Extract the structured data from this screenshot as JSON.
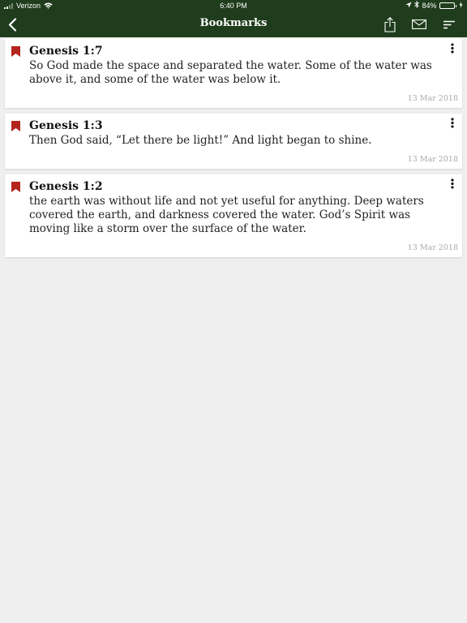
{
  "status_bar": {
    "carrier": "Verizon",
    "time": "6:40 PM",
    "battery_percent": "84%",
    "battery_level": 0.84,
    "battery_color": "#4cd964"
  },
  "nav": {
    "title": "Bookmarks",
    "back_icon": "chevron-left-icon",
    "share_icon": "share-icon",
    "mail_icon": "mail-icon",
    "sort_icon": "sort-icon",
    "bar_color": "#1f3d1c"
  },
  "bookmarks": [
    {
      "reference": "Genesis 1:7",
      "text": "So God made the space and separated the water. Some of the water was above it, and some of the water was below it.",
      "date": "13 Mar 2018"
    },
    {
      "reference": "Genesis 1:3",
      "text": "Then God said, “Let there be light!” And light began to shine.",
      "date": "13 Mar 2018"
    },
    {
      "reference": "Genesis 1:2",
      "text": "the earth was without life and not yet useful for anything. Deep waters covered the earth, and darkness covered the water. God’s Spirit was moving like a storm over the surface of the water.",
      "date": "13 Mar 2018"
    }
  ],
  "bookmark_icon": "bookmark-ribbon-icon",
  "bookmark_color": "#b5251f",
  "more_icon": "more-vertical-icon"
}
